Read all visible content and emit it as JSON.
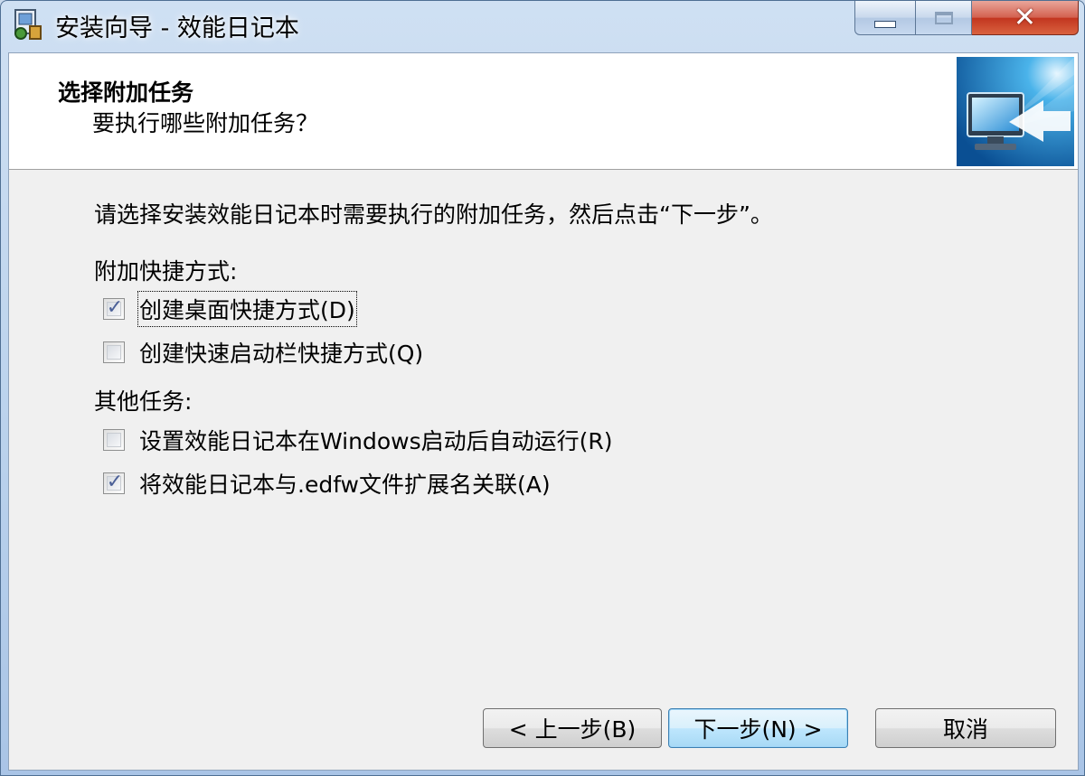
{
  "window": {
    "title": "安装向导 - 效能日记本",
    "controls": {
      "minimize": "minimize",
      "maximize": "maximize",
      "close": "✕"
    }
  },
  "header": {
    "title": "选择附加任务",
    "subtitle": "要执行哪些附加任务？"
  },
  "body": {
    "intro": "请选择安装效能日记本时需要执行的附加任务，然后点击“下一步”。",
    "groups": [
      {
        "label": "附加快捷方式:",
        "items": [
          {
            "label": "创建桌面快捷方式(D)",
            "checked": true
          },
          {
            "label": "创建快速启动栏快捷方式(Q)",
            "checked": false
          }
        ]
      },
      {
        "label": "其他任务:",
        "items": [
          {
            "label": "设置效能日记本在Windows启动后自动运行(R)",
            "checked": false
          },
          {
            "label": "将效能日记本与.edfw文件扩展名关联(A)",
            "checked": true
          }
        ]
      }
    ]
  },
  "footer": {
    "back": "< 上一步(B)",
    "next": "下一步(N) >",
    "cancel": "取消"
  },
  "colors": {
    "title_bar": "#b9d1ec",
    "client_bg": "#f0f0f0",
    "close_button": "#c2351f",
    "checkmark": "#4a5f97",
    "default_button_border": "#3c7fb1"
  }
}
